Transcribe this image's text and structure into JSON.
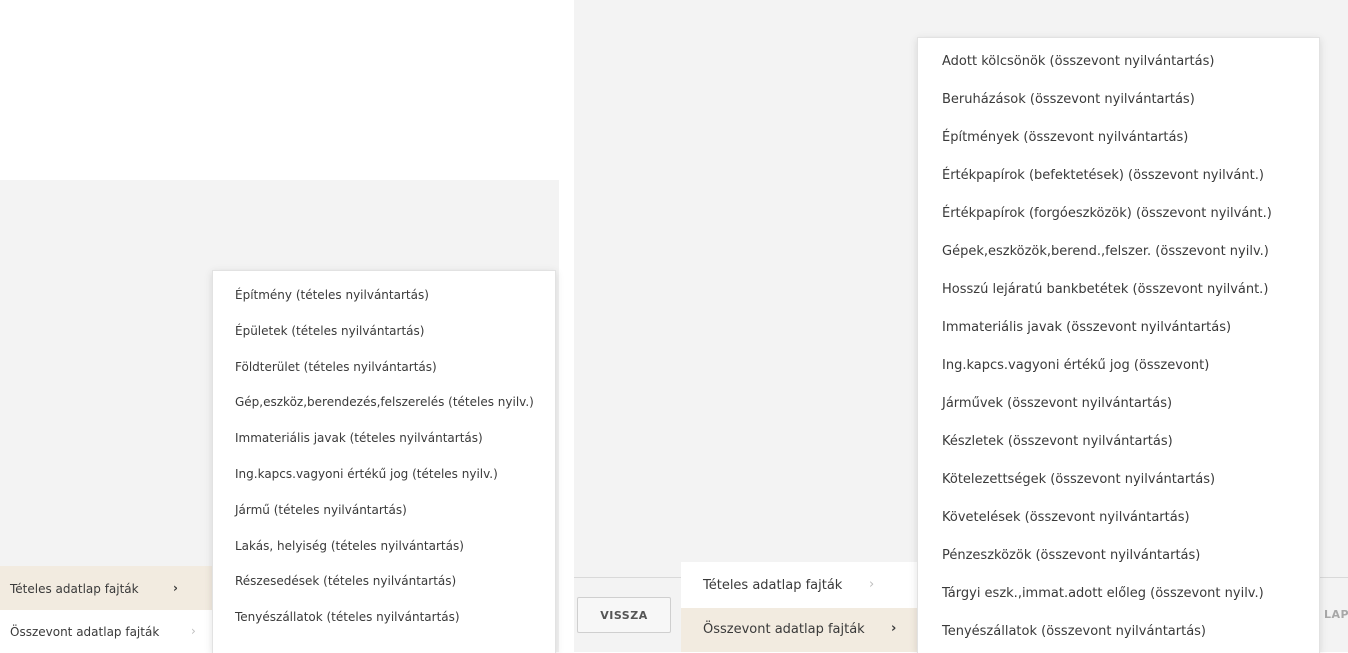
{
  "left": {
    "menu": [
      {
        "label": "Tételes adatlap fajták",
        "chevron": "›"
      },
      {
        "label": "Összevont adatlap fajták",
        "chevron": "›"
      }
    ],
    "submenu": [
      "Építmény (tételes nyilvántartás)",
      "Épületek (tételes nyilvántartás)",
      "Földterület (tételes nyilvántartás)",
      "Gép,eszköz,berendezés,felszerelés (tételes nyilv.)",
      "Immateriális javak (tételes nyilvántartás)",
      "Ing.kapcs.vagyoni értékű jog (tételes nyilv.)",
      "Jármű (tételes nyilvántartás)",
      "Lakás, helyiség (tételes nyilvántartás)",
      "Részesedések (tételes nyilvántartás)",
      "Tenyészállatok (tételes nyilvántartás)"
    ]
  },
  "right": {
    "back_label": "VISSZA",
    "clipped_label": "LAP",
    "menu": [
      {
        "label": "Tételes adatlap fajták",
        "chevron": "›"
      },
      {
        "label": "Összevont adatlap fajták",
        "chevron": "›"
      }
    ],
    "submenu": [
      "Adott kölcsönök (összevont nyilvántartás)",
      "Beruházások (összevont nyilvántartás)",
      "Építmények (összevont nyilvántartás)",
      "Értékpapírok (befektetések) (összevont nyilvánt.)",
      "Értékpapírok (forgóeszközök) (összevont nyilvánt.)",
      "Gépek,eszközök,berend.,felszer. (összevont nyilv.)",
      "Hosszú lejáratú bankbetétek (összevont nyilvánt.)",
      "Immateriális javak (összevont nyilvántartás)",
      "Ing.kapcs.vagyoni értékű jog (összevont)",
      "Járművek (összevont nyilvántartás)",
      "Készletek (összevont nyilvántartás)",
      "Kötelezettségek (összevont nyilvántartás)",
      "Követelések (összevont nyilvántartás)",
      "Pénzeszközök (összevont nyilvántartás)",
      "Tárgyi eszk.,immat.adott előleg (összevont nyilv.)",
      "Tenyészállatok (összevont nyilvántartás)"
    ]
  }
}
